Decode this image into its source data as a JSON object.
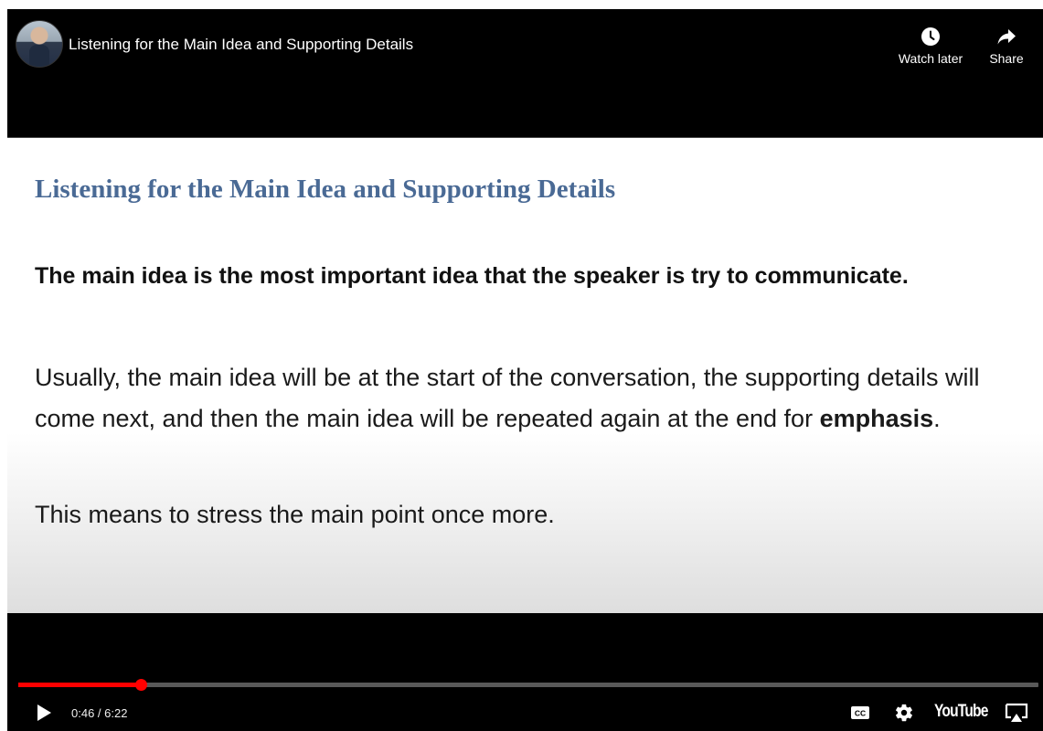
{
  "player": {
    "title": "Listening for the Main Idea and Supporting Details",
    "channel_avatar_icon": "channel-avatar",
    "actions": {
      "watch_later_label": "Watch later",
      "watch_later_icon": "clock-icon",
      "share_label": "Share",
      "share_icon": "share-arrow-icon"
    }
  },
  "slide": {
    "heading": "Listening for the Main Idea and Supporting Details",
    "main_idea": "The main idea is the most important idea that the speaker is try to communicate.",
    "paragraph_before_bold": "Usually, the main idea will be at the start of the conversation, the supporting details will come next, and then the main idea will be repeated again at the end for ",
    "paragraph_bold": "emphasis",
    "paragraph_after_bold": ".",
    "note": "This means to stress the main point once more."
  },
  "controls": {
    "current_time": "0:46",
    "duration": "6:22",
    "time_display": "0:46 / 6:22",
    "progress_fraction": 0.1204,
    "progress_color": "#ff0000",
    "play_icon": "play-icon",
    "cc_icon": "closed-captions-icon",
    "settings_icon": "gear-icon",
    "logo_text": "YouTube",
    "airplay_icon": "airplay-icon"
  }
}
